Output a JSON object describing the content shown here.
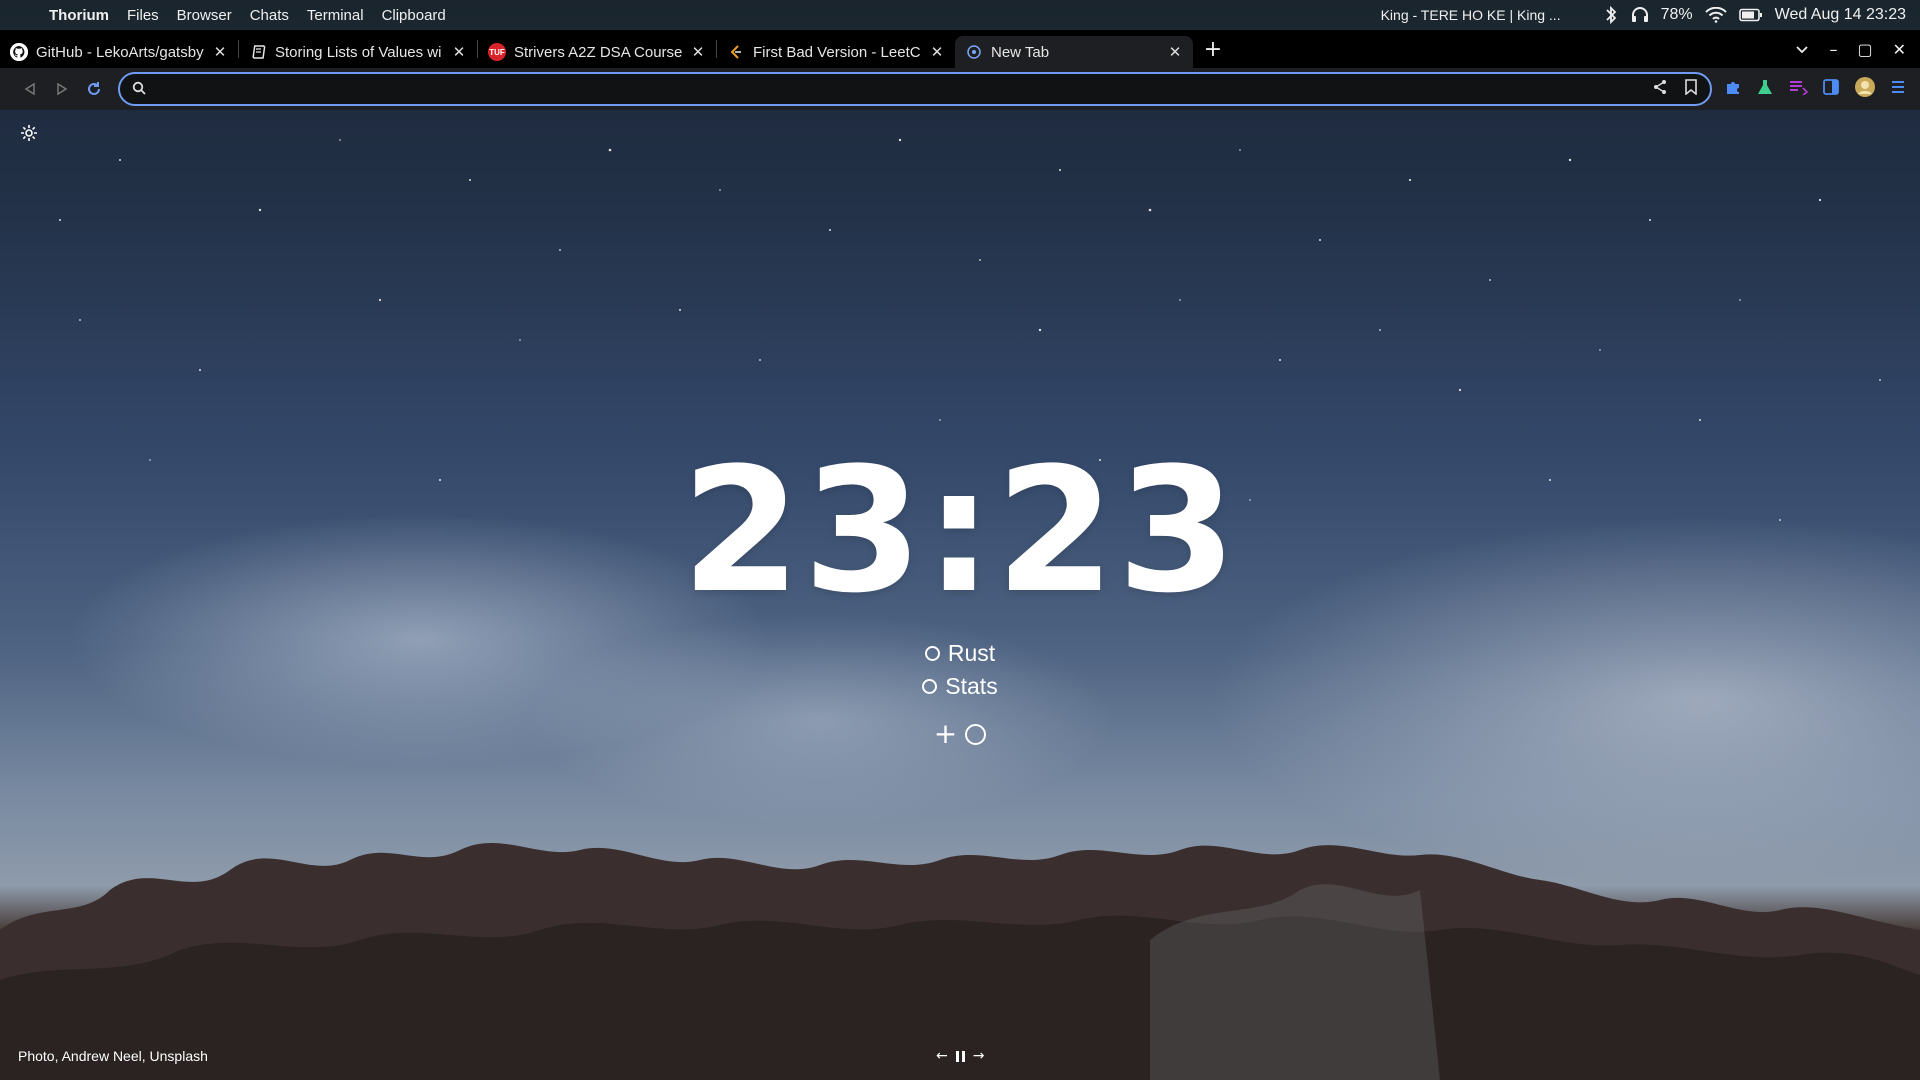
{
  "system_bar": {
    "apple_glyph": "",
    "app_name": "Thorium",
    "menus": [
      "Files",
      "Browser",
      "Chats",
      "Terminal",
      "Clipboard"
    ],
    "now_playing": "King - TERE HO KE | King ...",
    "battery": "78%",
    "datetime": "Wed Aug 14  23:23"
  },
  "tabs": [
    {
      "title": "GitHub - LekoArts/gatsby",
      "favicon": "github-icon",
      "active": false
    },
    {
      "title": "Storing Lists of Values wi",
      "favicon": "book-icon",
      "active": false
    },
    {
      "title": "Strivers A2Z DSA Course/",
      "favicon": "tuf-icon",
      "fav_text": "TUF",
      "active": false
    },
    {
      "title": "First Bad Version - LeetC",
      "favicon": "leetcode-icon",
      "active": false
    },
    {
      "title": "New Tab",
      "favicon": "newtab-icon",
      "active": true
    }
  ],
  "tab_close_glyph": "✕",
  "new_tab_glyph": "+",
  "window_controls": {
    "minimize": "–",
    "maximize": "▢",
    "close": "✕"
  },
  "omnibox": {
    "value": "",
    "placeholder": ""
  },
  "page": {
    "clock": "23:23",
    "todos": [
      {
        "label": "Rust",
        "done": false
      },
      {
        "label": "Stats",
        "done": false
      }
    ],
    "add_glyph": "+",
    "credit": "Photo, Andrew Neel, Unsplash",
    "prev_glyph": "←",
    "next_glyph": "→"
  },
  "colors": {
    "accent": "#6f9cf2",
    "toolbar_bg": "#1e1f22",
    "tabstrip_bg": "#000000"
  }
}
